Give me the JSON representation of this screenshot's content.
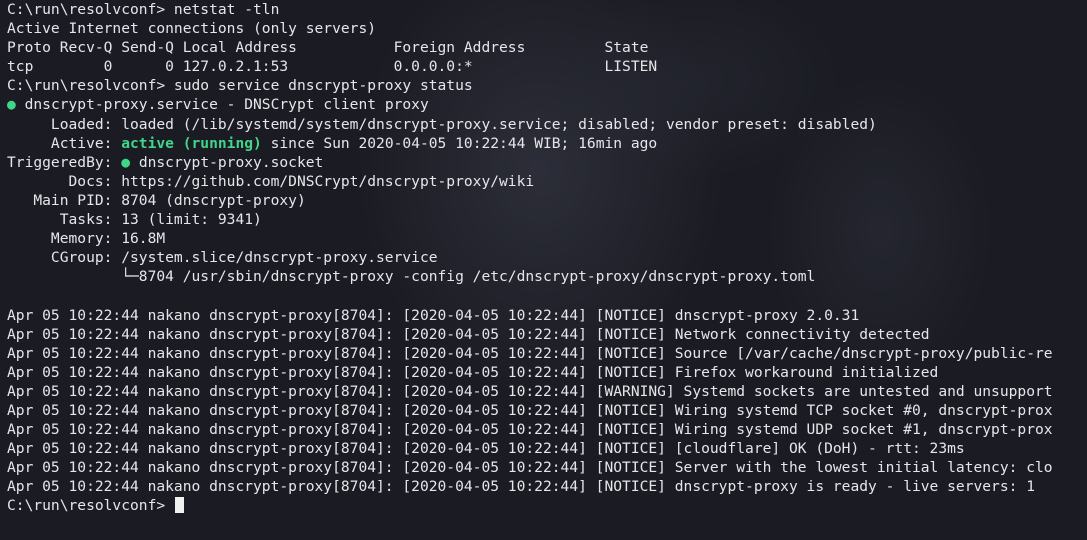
{
  "session": {
    "cmd1": "C:\\run\\resolvconf> netstat -tln",
    "netstat_title": "Active Internet connections (only servers)",
    "netstat_header": "Proto Recv-Q Send-Q Local Address           Foreign Address         State",
    "netstat_row": "tcp        0      0 127.0.2.1:53            0.0.0.0:*               LISTEN",
    "cmd2": "C:\\run\\resolvconf> sudo service dnscrypt-proxy status",
    "unit_dot": "●",
    "unit_line": " dnscrypt-proxy.service - DNSCrypt client proxy",
    "loaded_line": "     Loaded: loaded (/lib/systemd/system/dnscrypt-proxy.service; disabled; vendor preset: disabled)",
    "active_prefix": "     Active: ",
    "active_state": "active (running)",
    "active_suffix": " since Sun 2020-04-05 10:22:44 WIB; 16min ago",
    "triggered_prefix": "TriggeredBy: ",
    "triggered_dot": "●",
    "triggered_suffix": " dnscrypt-proxy.socket",
    "docs_line": "       Docs: https://github.com/DNSCrypt/dnscrypt-proxy/wiki",
    "mainpid_line": "   Main PID: 8704 (dnscrypt-proxy)",
    "tasks_line": "      Tasks: 13 (limit: 9341)",
    "memory_line": "     Memory: 16.8M",
    "cgroup_line": "     CGroup: /system.slice/dnscrypt-proxy.service",
    "cgroup_child": "             └─8704 /usr/sbin/dnscrypt-proxy -config /etc/dnscrypt-proxy/dnscrypt-proxy.toml",
    "logs": [
      "Apr 05 10:22:44 nakano dnscrypt-proxy[8704]: [2020-04-05 10:22:44] [NOTICE] dnscrypt-proxy 2.0.31",
      "Apr 05 10:22:44 nakano dnscrypt-proxy[8704]: [2020-04-05 10:22:44] [NOTICE] Network connectivity detected",
      "Apr 05 10:22:44 nakano dnscrypt-proxy[8704]: [2020-04-05 10:22:44] [NOTICE] Source [/var/cache/dnscrypt-proxy/public-re",
      "Apr 05 10:22:44 nakano dnscrypt-proxy[8704]: [2020-04-05 10:22:44] [NOTICE] Firefox workaround initialized",
      "Apr 05 10:22:44 nakano dnscrypt-proxy[8704]: [2020-04-05 10:22:44] [WARNING] Systemd sockets are untested and unsupport",
      "Apr 05 10:22:44 nakano dnscrypt-proxy[8704]: [2020-04-05 10:22:44] [NOTICE] Wiring systemd TCP socket #0, dnscrypt-prox",
      "Apr 05 10:22:44 nakano dnscrypt-proxy[8704]: [2020-04-05 10:22:44] [NOTICE] Wiring systemd UDP socket #1, dnscrypt-prox",
      "Apr 05 10:22:44 nakano dnscrypt-proxy[8704]: [2020-04-05 10:22:44] [NOTICE] [cloudflare] OK (DoH) - rtt: 23ms",
      "Apr 05 10:22:44 nakano dnscrypt-proxy[8704]: [2020-04-05 10:22:44] [NOTICE] Server with the lowest initial latency: clo",
      "Apr 05 10:22:44 nakano dnscrypt-proxy[8704]: [2020-04-05 10:22:44] [NOTICE] dnscrypt-proxy is ready - live servers: 1"
    ],
    "prompt": "C:\\run\\resolvconf> "
  },
  "colors": {
    "background": "#1b1c23",
    "foreground": "#e6e6ea",
    "active_green": "#3fd68a"
  }
}
